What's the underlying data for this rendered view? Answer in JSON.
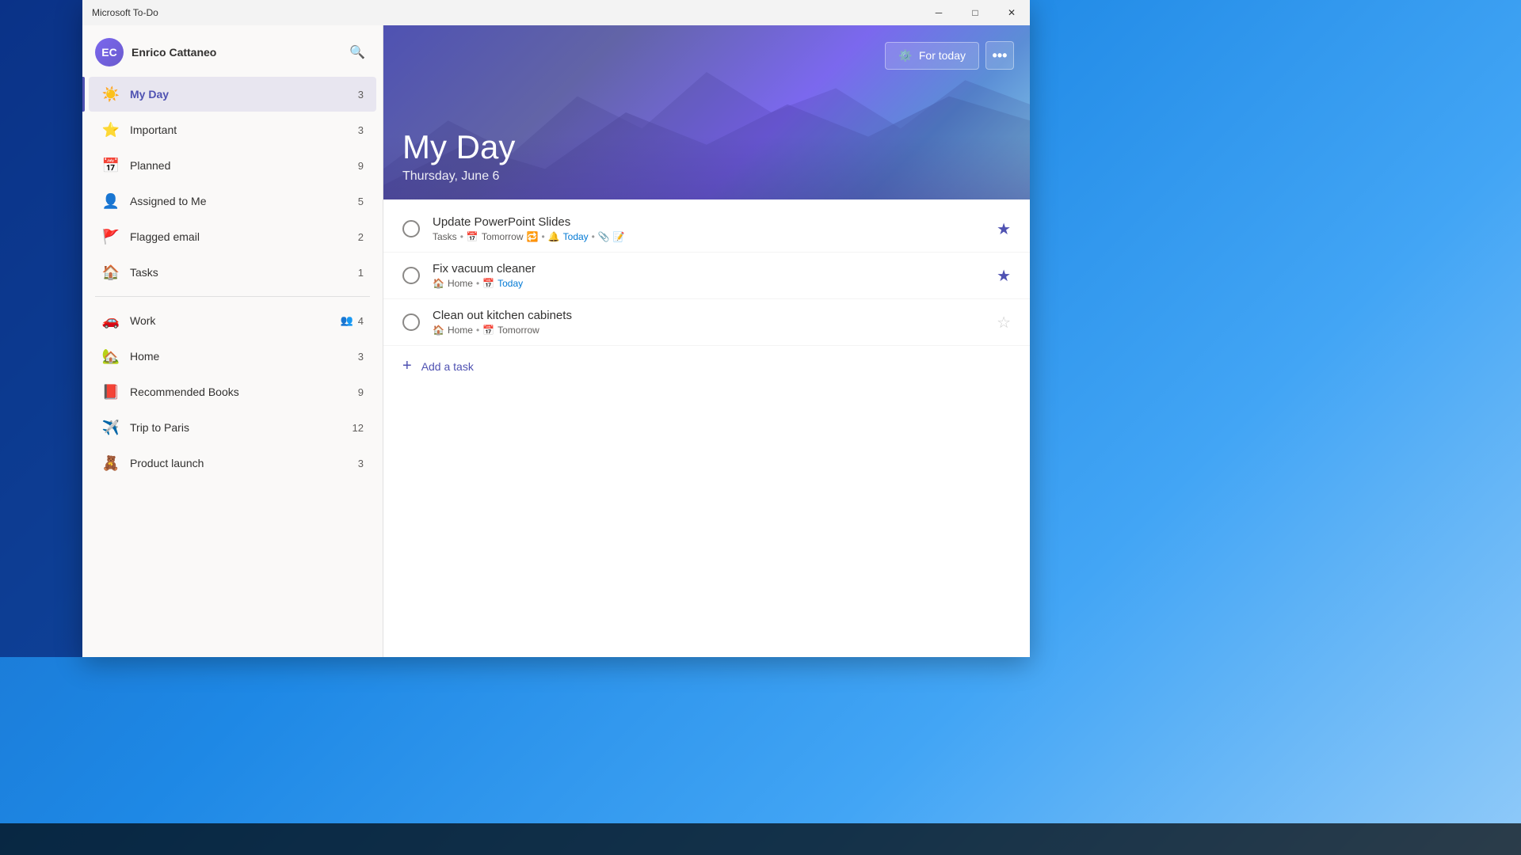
{
  "app": {
    "title": "Microsoft To-Do",
    "window_title": "Microsoft To-Do"
  },
  "titlebar": {
    "title": "Microsoft To-Do",
    "minimize_label": "─",
    "maximize_label": "□",
    "close_label": "✕"
  },
  "sidebar": {
    "user_name": "Enrico Cattaneo",
    "user_initials": "EC",
    "nav_items": [
      {
        "id": "my-day",
        "label": "My Day",
        "icon": "☀",
        "count": "3",
        "active": true
      },
      {
        "id": "important",
        "label": "Important",
        "icon": "☆",
        "count": "3",
        "active": false
      },
      {
        "id": "planned",
        "label": "Planned",
        "icon": "▦",
        "count": "9",
        "active": false
      },
      {
        "id": "assigned-to-me",
        "label": "Assigned to Me",
        "icon": "👥",
        "count": "5",
        "active": false
      },
      {
        "id": "flagged-email",
        "label": "Flagged email",
        "icon": "⚑",
        "count": "2",
        "active": false
      },
      {
        "id": "tasks",
        "label": "Tasks",
        "icon": "⌂",
        "count": "1",
        "active": false
      }
    ],
    "lists": [
      {
        "id": "work",
        "label": "Work",
        "icon": "🚗",
        "count": "4",
        "shared": true
      },
      {
        "id": "home",
        "label": "Home",
        "icon": "🏠",
        "count": "3"
      },
      {
        "id": "recommended-books",
        "label": "Recommended Books",
        "icon": "📕",
        "count": "9"
      },
      {
        "id": "trip-to-paris",
        "label": "Trip to Paris",
        "icon": "✈",
        "count": "12"
      },
      {
        "id": "product-launch",
        "label": "Product launch",
        "icon": "🧸",
        "count": "3"
      }
    ]
  },
  "hero": {
    "title": "My Day",
    "subtitle": "Thursday, June 6",
    "for_today_label": "For today",
    "more_label": "•••"
  },
  "tasks": [
    {
      "id": "task-1",
      "title": "Update PowerPoint Slides",
      "list": "Tasks",
      "due_relative": "Tomorrow",
      "reminder": "Today",
      "starred": true,
      "has_recurrence": true
    },
    {
      "id": "task-2",
      "title": "Fix vacuum cleaner",
      "list": "Home",
      "due_relative": "Today",
      "starred": true
    },
    {
      "id": "task-3",
      "title": "Clean out kitchen cabinets",
      "list": "Home",
      "due_relative": "Tomorrow",
      "starred": false
    }
  ],
  "add_task": {
    "label": "Add a task"
  }
}
